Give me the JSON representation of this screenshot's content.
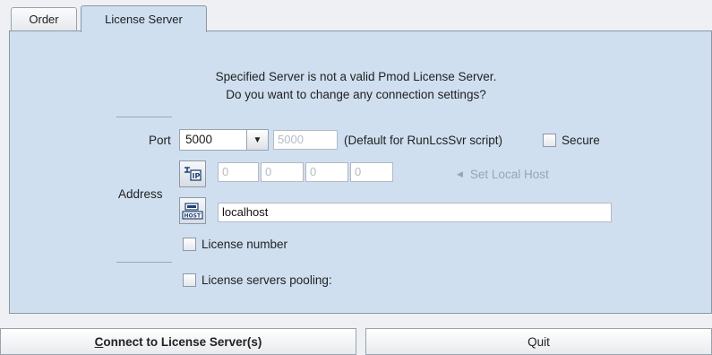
{
  "tabs": [
    {
      "label": "Order"
    },
    {
      "label": "License Server"
    }
  ],
  "message": {
    "line1": "Specified Server is not a valid Pmod License Server.",
    "line2": "Do you want to change any connection settings?"
  },
  "port": {
    "label": "Port",
    "selected": "5000",
    "field_value": "5000",
    "default_note": "(Default for RunLcsSvr script)",
    "secure_label": "Secure",
    "secure_checked": false
  },
  "address": {
    "label": "Address",
    "ip_octets": [
      "0",
      "0",
      "0",
      "0"
    ],
    "set_local_host_label": "Set Local Host",
    "host_value": "localhost"
  },
  "options": {
    "license_number_label": "License number",
    "license_number_checked": false,
    "pooling_label": "License servers pooling:",
    "pooling_checked": false
  },
  "buttons": {
    "connect_mnemonic": "C",
    "connect_rest": "onnect to License Server(s)",
    "quit": "Quit"
  },
  "colors": {
    "panel_bg": "#cfdff0",
    "window_bg": "#eef0f3"
  },
  "icons": {
    "ip": "ip-address-icon",
    "host": "host-name-icon",
    "set_local": "triangle-left-icon",
    "dropdown": "chevron-down-icon"
  }
}
